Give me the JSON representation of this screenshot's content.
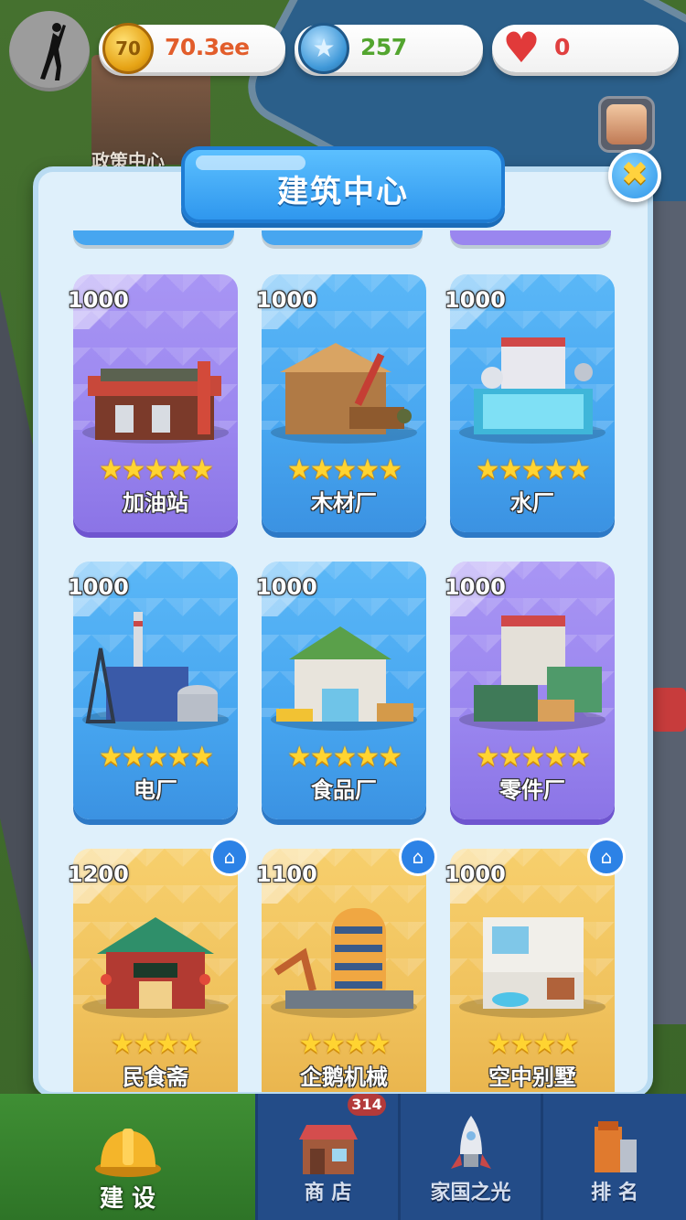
{
  "hud": {
    "coins": "70.3ee",
    "coin_icon_text": "70",
    "stars": "257",
    "hearts": "0"
  },
  "background": {
    "building_label": "政策中心"
  },
  "panel": {
    "title": "建筑中心",
    "close_symbol": "✖"
  },
  "cards": [
    {
      "price": "1000",
      "name": "加油站",
      "stars": 5,
      "theme": "purple",
      "icon": "gas-station-icon"
    },
    {
      "price": "1000",
      "name": "木材厂",
      "stars": 5,
      "theme": "blue",
      "icon": "lumber-mill-icon"
    },
    {
      "price": "1000",
      "name": "水厂",
      "stars": 5,
      "theme": "blue",
      "icon": "water-plant-icon"
    },
    {
      "price": "1000",
      "name": "电厂",
      "stars": 5,
      "theme": "blue",
      "icon": "power-plant-icon"
    },
    {
      "price": "1000",
      "name": "食品厂",
      "stars": 5,
      "theme": "blue",
      "icon": "food-factory-icon"
    },
    {
      "price": "1000",
      "name": "零件厂",
      "stars": 5,
      "theme": "purple",
      "icon": "parts-factory-icon"
    },
    {
      "price": "1200",
      "name": "民食斋",
      "stars": 4,
      "theme": "gold",
      "icon": "restaurant-icon",
      "home_badge": true
    },
    {
      "price": "1100",
      "name": "企鹅机械",
      "stars": 4,
      "theme": "gold",
      "icon": "machinery-tower-icon",
      "home_badge": true
    },
    {
      "price": "1000",
      "name": "空中别墅",
      "stars": 4,
      "theme": "gold",
      "icon": "villa-icon",
      "home_badge": true
    }
  ],
  "nav": {
    "tabs": [
      {
        "label": "建 设",
        "icon": "hard-hat-icon",
        "active": true
      },
      {
        "label": "商 店",
        "icon": "shop-icon",
        "active": false
      },
      {
        "label": "家国之光",
        "icon": "rocket-icon",
        "active": false
      },
      {
        "label": "排 名",
        "icon": "ranking-icon",
        "active": false
      }
    ],
    "shop_badge": "314"
  },
  "colors": {
    "blue_card": "#47a6f0",
    "purple_card": "#9a86ef",
    "gold_card": "#f0c25d",
    "panel_bg": "#dff0fb",
    "nav_bg": "#234c88"
  }
}
